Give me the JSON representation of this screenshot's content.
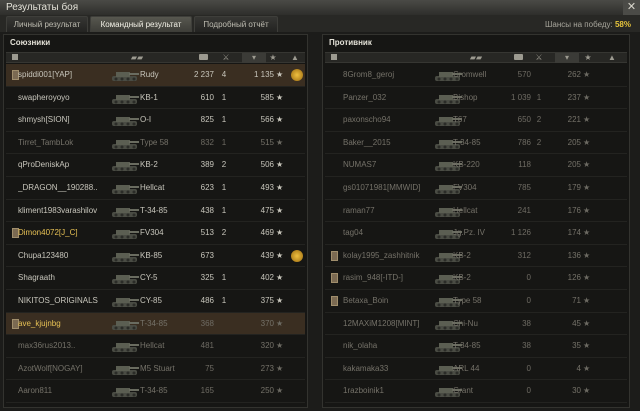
{
  "window": {
    "title": "Результаты боя",
    "close_label": "✕"
  },
  "tabs": [
    {
      "label": "Личный результат",
      "active": false
    },
    {
      "label": "Командный результат",
      "active": true
    },
    {
      "label": "Подробный отчёт",
      "active": false
    }
  ],
  "win_chance": {
    "label": "Шансы на победу:",
    "value": "58%"
  },
  "allies": {
    "title": "Союзники",
    "rows": [
      {
        "name": "spiddi001[YAP]",
        "tank": "Rudy",
        "damage": "2 237",
        "kills": "4",
        "xp": "1 135",
        "clan": true,
        "player": true,
        "medal": true,
        "dead": false
      },
      {
        "name": "swapheroyoyo",
        "tank": "KB-1",
        "damage": "610",
        "kills": "1",
        "xp": "585",
        "clan": false,
        "player": false,
        "medal": false,
        "dead": false
      },
      {
        "name": "shmysh[SION]",
        "tank": "O-I",
        "damage": "825",
        "kills": "1",
        "xp": "566",
        "clan": false,
        "player": false,
        "medal": false,
        "dead": false
      },
      {
        "name": "Tirret_TambLok",
        "tank": "Type 58",
        "damage": "832",
        "kills": "1",
        "xp": "515",
        "clan": false,
        "player": false,
        "medal": false,
        "dead": true
      },
      {
        "name": "qProDeniskAp",
        "tank": "KB-2",
        "damage": "389",
        "kills": "2",
        "xp": "506",
        "clan": false,
        "player": false,
        "medal": false,
        "dead": false
      },
      {
        "name": "_DRAGON__190288..",
        "tank": "Hellcat",
        "damage": "623",
        "kills": "1",
        "xp": "493",
        "clan": false,
        "player": false,
        "medal": false,
        "dead": false
      },
      {
        "name": "kliment1983varashilov",
        "tank": "T-34-85",
        "damage": "438",
        "kills": "1",
        "xp": "475",
        "clan": false,
        "player": false,
        "medal": false,
        "dead": false
      },
      {
        "name": "Dimon4072[J_C]",
        "tank": "FV304",
        "damage": "513",
        "kills": "2",
        "xp": "469",
        "clan": true,
        "player": false,
        "medal": false,
        "dead": false,
        "gold": true
      },
      {
        "name": "Chupa123480",
        "tank": "KB-85",
        "damage": "673",
        "kills": "",
        "xp": "439",
        "clan": false,
        "player": false,
        "medal": true,
        "dead": false
      },
      {
        "name": "Shagraath",
        "tank": "CY-5",
        "damage": "325",
        "kills": "1",
        "xp": "402",
        "clan": false,
        "player": false,
        "medal": false,
        "dead": false
      },
      {
        "name": "NIKITOS_ORIGINALS",
        "tank": "CY-85",
        "damage": "486",
        "kills": "1",
        "xp": "375",
        "clan": false,
        "player": false,
        "medal": false,
        "dead": false
      },
      {
        "name": "ave_kjujnbg",
        "tank": "T-34-85",
        "damage": "368",
        "kills": "",
        "xp": "370",
        "clan": true,
        "player": true,
        "medal": false,
        "dead": true,
        "gold": true
      },
      {
        "name": "max36rus2013..",
        "tank": "Hellcat",
        "damage": "481",
        "kills": "",
        "xp": "320",
        "clan": false,
        "player": false,
        "medal": false,
        "dead": true
      },
      {
        "name": "AzotWolf[NOGAY]",
        "tank": "M5 Stuart",
        "damage": "75",
        "kills": "",
        "xp": "273",
        "clan": false,
        "player": false,
        "medal": false,
        "dead": true
      },
      {
        "name": "Aaron811",
        "tank": "T-34-85",
        "damage": "165",
        "kills": "",
        "xp": "250",
        "clan": false,
        "player": false,
        "medal": false,
        "dead": true
      }
    ]
  },
  "enemies": {
    "title": "Противник",
    "rows": [
      {
        "name": "8Grom8_geroj",
        "tank": "Cromwell",
        "damage": "570",
        "kills": "",
        "xp": "262",
        "clan": false,
        "dead": true
      },
      {
        "name": "Panzer_032",
        "tank": "Bishop",
        "damage": "1 039",
        "kills": "1",
        "xp": "237",
        "clan": false,
        "dead": true
      },
      {
        "name": "paxonscho94",
        "tank": "T67",
        "damage": "650",
        "kills": "2",
        "xp": "221",
        "clan": false,
        "dead": true
      },
      {
        "name": "Baker__2015",
        "tank": "T-34-85",
        "damage": "786",
        "kills": "2",
        "xp": "205",
        "clan": false,
        "dead": true
      },
      {
        "name": "NUMAS7",
        "tank": "KB-220",
        "damage": "118",
        "kills": "",
        "xp": "205",
        "clan": false,
        "dead": true
      },
      {
        "name": "gs01071981[MMWID]",
        "tank": "FV304",
        "damage": "785",
        "kills": "",
        "xp": "179",
        "clan": false,
        "dead": true
      },
      {
        "name": "raman77",
        "tank": "Hellcat",
        "damage": "241",
        "kills": "",
        "xp": "176",
        "clan": false,
        "dead": true
      },
      {
        "name": "tag04",
        "tank": "Jg.Pz. IV",
        "damage": "1 126",
        "kills": "",
        "xp": "174",
        "clan": false,
        "dead": true
      },
      {
        "name": "kolay1995_zashhitnik",
        "tank": "KB-2",
        "damage": "312",
        "kills": "",
        "xp": "136",
        "clan": true,
        "dead": true
      },
      {
        "name": "rasim_948[-ITD-]",
        "tank": "KB-2",
        "damage": "0",
        "kills": "",
        "xp": "126",
        "clan": true,
        "dead": true
      },
      {
        "name": "Betaxa_Boin",
        "tank": "Type 58",
        "damage": "0",
        "kills": "",
        "xp": "71",
        "clan": true,
        "dead": true
      },
      {
        "name": "12MAXiM1208[MINT]",
        "tank": "Chi-Nu",
        "damage": "38",
        "kills": "",
        "xp": "45",
        "clan": false,
        "dead": true
      },
      {
        "name": "nik_olaha",
        "tank": "T-34-85",
        "damage": "38",
        "kills": "",
        "xp": "35",
        "clan": false,
        "dead": true
      },
      {
        "name": "kakamaka33",
        "tank": "ARL 44",
        "damage": "0",
        "kills": "",
        "xp": "4",
        "clan": false,
        "dead": true
      },
      {
        "name": "1razboinik1",
        "tank": "Grant",
        "damage": "0",
        "kills": "",
        "xp": "30",
        "clan": false,
        "dead": true
      }
    ]
  },
  "colors": {
    "gold": "#e6c054",
    "player_row": "#3a2e21",
    "win_chance": "#e6c43c"
  }
}
